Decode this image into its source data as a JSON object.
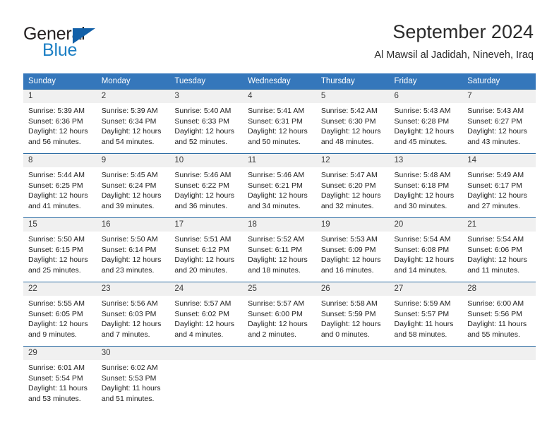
{
  "brand": {
    "line1": "General",
    "line2": "Blue",
    "flag_color": "#1260a8",
    "blue_color": "#1c7fc4"
  },
  "header": {
    "title": "September 2024",
    "location": "Al Mawsil al Jadidah, Nineveh, Iraq"
  },
  "theme": {
    "header_bg": "#3577bb",
    "row_border": "#2e6da4",
    "daynum_bg": "#f0f0f0"
  },
  "weekdays": [
    "Sunday",
    "Monday",
    "Tuesday",
    "Wednesday",
    "Thursday",
    "Friday",
    "Saturday"
  ],
  "weeks": [
    [
      {
        "day": "1",
        "sunrise": "Sunrise: 5:39 AM",
        "sunset": "Sunset: 6:36 PM",
        "daylight1": "Daylight: 12 hours",
        "daylight2": "and 56 minutes."
      },
      {
        "day": "2",
        "sunrise": "Sunrise: 5:39 AM",
        "sunset": "Sunset: 6:34 PM",
        "daylight1": "Daylight: 12 hours",
        "daylight2": "and 54 minutes."
      },
      {
        "day": "3",
        "sunrise": "Sunrise: 5:40 AM",
        "sunset": "Sunset: 6:33 PM",
        "daylight1": "Daylight: 12 hours",
        "daylight2": "and 52 minutes."
      },
      {
        "day": "4",
        "sunrise": "Sunrise: 5:41 AM",
        "sunset": "Sunset: 6:31 PM",
        "daylight1": "Daylight: 12 hours",
        "daylight2": "and 50 minutes."
      },
      {
        "day": "5",
        "sunrise": "Sunrise: 5:42 AM",
        "sunset": "Sunset: 6:30 PM",
        "daylight1": "Daylight: 12 hours",
        "daylight2": "and 48 minutes."
      },
      {
        "day": "6",
        "sunrise": "Sunrise: 5:43 AM",
        "sunset": "Sunset: 6:28 PM",
        "daylight1": "Daylight: 12 hours",
        "daylight2": "and 45 minutes."
      },
      {
        "day": "7",
        "sunrise": "Sunrise: 5:43 AM",
        "sunset": "Sunset: 6:27 PM",
        "daylight1": "Daylight: 12 hours",
        "daylight2": "and 43 minutes."
      }
    ],
    [
      {
        "day": "8",
        "sunrise": "Sunrise: 5:44 AM",
        "sunset": "Sunset: 6:25 PM",
        "daylight1": "Daylight: 12 hours",
        "daylight2": "and 41 minutes."
      },
      {
        "day": "9",
        "sunrise": "Sunrise: 5:45 AM",
        "sunset": "Sunset: 6:24 PM",
        "daylight1": "Daylight: 12 hours",
        "daylight2": "and 39 minutes."
      },
      {
        "day": "10",
        "sunrise": "Sunrise: 5:46 AM",
        "sunset": "Sunset: 6:22 PM",
        "daylight1": "Daylight: 12 hours",
        "daylight2": "and 36 minutes."
      },
      {
        "day": "11",
        "sunrise": "Sunrise: 5:46 AM",
        "sunset": "Sunset: 6:21 PM",
        "daylight1": "Daylight: 12 hours",
        "daylight2": "and 34 minutes."
      },
      {
        "day": "12",
        "sunrise": "Sunrise: 5:47 AM",
        "sunset": "Sunset: 6:20 PM",
        "daylight1": "Daylight: 12 hours",
        "daylight2": "and 32 minutes."
      },
      {
        "day": "13",
        "sunrise": "Sunrise: 5:48 AM",
        "sunset": "Sunset: 6:18 PM",
        "daylight1": "Daylight: 12 hours",
        "daylight2": "and 30 minutes."
      },
      {
        "day": "14",
        "sunrise": "Sunrise: 5:49 AM",
        "sunset": "Sunset: 6:17 PM",
        "daylight1": "Daylight: 12 hours",
        "daylight2": "and 27 minutes."
      }
    ],
    [
      {
        "day": "15",
        "sunrise": "Sunrise: 5:50 AM",
        "sunset": "Sunset: 6:15 PM",
        "daylight1": "Daylight: 12 hours",
        "daylight2": "and 25 minutes."
      },
      {
        "day": "16",
        "sunrise": "Sunrise: 5:50 AM",
        "sunset": "Sunset: 6:14 PM",
        "daylight1": "Daylight: 12 hours",
        "daylight2": "and 23 minutes."
      },
      {
        "day": "17",
        "sunrise": "Sunrise: 5:51 AM",
        "sunset": "Sunset: 6:12 PM",
        "daylight1": "Daylight: 12 hours",
        "daylight2": "and 20 minutes."
      },
      {
        "day": "18",
        "sunrise": "Sunrise: 5:52 AM",
        "sunset": "Sunset: 6:11 PM",
        "daylight1": "Daylight: 12 hours",
        "daylight2": "and 18 minutes."
      },
      {
        "day": "19",
        "sunrise": "Sunrise: 5:53 AM",
        "sunset": "Sunset: 6:09 PM",
        "daylight1": "Daylight: 12 hours",
        "daylight2": "and 16 minutes."
      },
      {
        "day": "20",
        "sunrise": "Sunrise: 5:54 AM",
        "sunset": "Sunset: 6:08 PM",
        "daylight1": "Daylight: 12 hours",
        "daylight2": "and 14 minutes."
      },
      {
        "day": "21",
        "sunrise": "Sunrise: 5:54 AM",
        "sunset": "Sunset: 6:06 PM",
        "daylight1": "Daylight: 12 hours",
        "daylight2": "and 11 minutes."
      }
    ],
    [
      {
        "day": "22",
        "sunrise": "Sunrise: 5:55 AM",
        "sunset": "Sunset: 6:05 PM",
        "daylight1": "Daylight: 12 hours",
        "daylight2": "and 9 minutes."
      },
      {
        "day": "23",
        "sunrise": "Sunrise: 5:56 AM",
        "sunset": "Sunset: 6:03 PM",
        "daylight1": "Daylight: 12 hours",
        "daylight2": "and 7 minutes."
      },
      {
        "day": "24",
        "sunrise": "Sunrise: 5:57 AM",
        "sunset": "Sunset: 6:02 PM",
        "daylight1": "Daylight: 12 hours",
        "daylight2": "and 4 minutes."
      },
      {
        "day": "25",
        "sunrise": "Sunrise: 5:57 AM",
        "sunset": "Sunset: 6:00 PM",
        "daylight1": "Daylight: 12 hours",
        "daylight2": "and 2 minutes."
      },
      {
        "day": "26",
        "sunrise": "Sunrise: 5:58 AM",
        "sunset": "Sunset: 5:59 PM",
        "daylight1": "Daylight: 12 hours",
        "daylight2": "and 0 minutes."
      },
      {
        "day": "27",
        "sunrise": "Sunrise: 5:59 AM",
        "sunset": "Sunset: 5:57 PM",
        "daylight1": "Daylight: 11 hours",
        "daylight2": "and 58 minutes."
      },
      {
        "day": "28",
        "sunrise": "Sunrise: 6:00 AM",
        "sunset": "Sunset: 5:56 PM",
        "daylight1": "Daylight: 11 hours",
        "daylight2": "and 55 minutes."
      }
    ],
    [
      {
        "day": "29",
        "sunrise": "Sunrise: 6:01 AM",
        "sunset": "Sunset: 5:54 PM",
        "daylight1": "Daylight: 11 hours",
        "daylight2": "and 53 minutes."
      },
      {
        "day": "30",
        "sunrise": "Sunrise: 6:02 AM",
        "sunset": "Sunset: 5:53 PM",
        "daylight1": "Daylight: 11 hours",
        "daylight2": "and 51 minutes."
      },
      {
        "day": "",
        "sunrise": "",
        "sunset": "",
        "daylight1": "",
        "daylight2": ""
      },
      {
        "day": "",
        "sunrise": "",
        "sunset": "",
        "daylight1": "",
        "daylight2": ""
      },
      {
        "day": "",
        "sunrise": "",
        "sunset": "",
        "daylight1": "",
        "daylight2": ""
      },
      {
        "day": "",
        "sunrise": "",
        "sunset": "",
        "daylight1": "",
        "daylight2": ""
      },
      {
        "day": "",
        "sunrise": "",
        "sunset": "",
        "daylight1": "",
        "daylight2": ""
      }
    ]
  ]
}
